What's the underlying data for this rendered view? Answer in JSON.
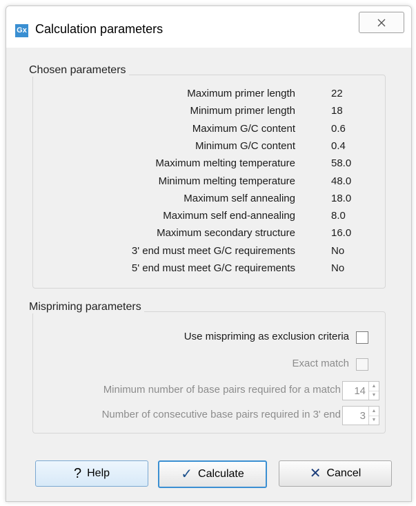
{
  "window": {
    "title": "Calculation parameters",
    "app_icon_text": "Gx",
    "close_icon": "close-icon"
  },
  "chosen": {
    "title": "Chosen parameters",
    "rows": [
      {
        "label": "Maximum primer length",
        "value": "22"
      },
      {
        "label": "Minimum primer length",
        "value": "18"
      },
      {
        "label": "Maximum G/C content",
        "value": "0.6"
      },
      {
        "label": "Minimum G/C content",
        "value": "0.4"
      },
      {
        "label": "Maximum melting temperature",
        "value": "58.0"
      },
      {
        "label": "Minimum melting temperature",
        "value": "48.0"
      },
      {
        "label": "Maximum self annealing",
        "value": "18.0"
      },
      {
        "label": "Maximum self end-annealing",
        "value": "8.0"
      },
      {
        "label": "Maximum secondary structure",
        "value": "16.0"
      },
      {
        "label": "3' end must meet G/C requirements",
        "value": "No"
      },
      {
        "label": "5' end must meet G/C requirements",
        "value": "No"
      }
    ]
  },
  "mispriming": {
    "title": "Mispriming parameters",
    "use_label": "Use mispriming as exclusion criteria",
    "use_checked": false,
    "exact_label": "Exact match",
    "exact_checked": false,
    "min_pairs_label": "Minimum number of base pairs required for a match",
    "min_pairs_value": "14",
    "consecutive_label": "Number of consecutive base pairs required in 3' end",
    "consecutive_value": "3"
  },
  "buttons": {
    "help": {
      "label": "Help",
      "icon": "?"
    },
    "calculate": {
      "label": "Calculate",
      "icon": "✓"
    },
    "cancel": {
      "label": "Cancel",
      "icon": "✕"
    }
  },
  "colors": {
    "accent": "#3a8fd2",
    "dialog_bg": "#f0f0f0",
    "disabled_text": "#8c8c8c"
  }
}
